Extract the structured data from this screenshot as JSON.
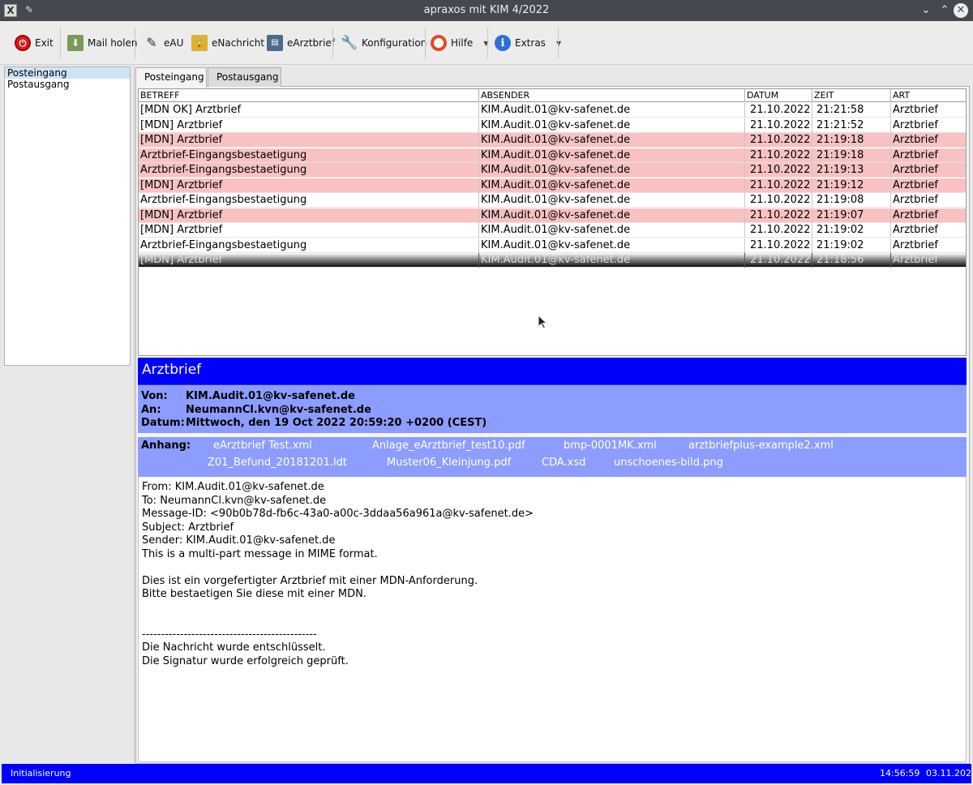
{
  "window": {
    "title": "apraxos mit KIM 4/2022",
    "app_icon": "x-app-icon",
    "pin_icon": "pin-icon",
    "min_glyph": "⌄",
    "max_glyph": "⌃",
    "close_glyph": "✕"
  },
  "toolbar": {
    "items": [
      {
        "label": "Exit",
        "icon": "power-icon",
        "glyph": "⏻"
      },
      {
        "label": "Mail holen",
        "icon": "download-icon",
        "glyph": "⬇"
      },
      {
        "label": "eAU",
        "icon": "pen-icon",
        "glyph": "✎"
      },
      {
        "label": "eNachricht",
        "icon": "lock-icon",
        "glyph": "🔒"
      },
      {
        "label": "eArztbrief",
        "icon": "printer-icon",
        "glyph": "▤"
      },
      {
        "label": "Konfiguration",
        "icon": "wrench-icon",
        "glyph": "🔧"
      },
      {
        "label": "Hilfe",
        "icon": "lifebuoy-icon",
        "glyph": ""
      },
      {
        "label": "Extras",
        "icon": "info-icon",
        "glyph": "i"
      }
    ],
    "dropdown_glyph": "▼"
  },
  "sidebar": {
    "items": [
      "Posteingang",
      "Postausgang"
    ]
  },
  "tabs": [
    "Posteingang",
    "Postausgang"
  ],
  "table": {
    "columns": [
      "BETREFF",
      "ABSENDER",
      "DATUM",
      "ZEIT",
      "ART"
    ],
    "rows": [
      {
        "betreff": "[MDN OK] Arztbrief",
        "absender": "KIM.Audit.01@kv-safenet.de",
        "datum": "21.10.2022",
        "zeit": "21:21:58",
        "art": "Arztbrief",
        "state": "normal"
      },
      {
        "betreff": "[MDN] Arztbrief",
        "absender": "KIM.Audit.01@kv-safenet.de",
        "datum": "21.10.2022",
        "zeit": "21:21:52",
        "art": "Arztbrief",
        "state": "normal"
      },
      {
        "betreff": "[MDN] Arztbrief",
        "absender": "KIM.Audit.01@kv-safenet.de",
        "datum": "21.10.2022",
        "zeit": "21:19:18",
        "art": "Arztbrief",
        "state": "unread"
      },
      {
        "betreff": "Arztbrief-Eingangsbestaetigung",
        "absender": "KIM.Audit.01@kv-safenet.de",
        "datum": "21.10.2022",
        "zeit": "21:19:18",
        "art": "Arztbrief",
        "state": "unread"
      },
      {
        "betreff": "Arztbrief-Eingangsbestaetigung",
        "absender": "KIM.Audit.01@kv-safenet.de",
        "datum": "21.10.2022",
        "zeit": "21:19:13",
        "art": "Arztbrief",
        "state": "unread"
      },
      {
        "betreff": "[MDN] Arztbrief",
        "absender": "KIM.Audit.01@kv-safenet.de",
        "datum": "21.10.2022",
        "zeit": "21:19:12",
        "art": "Arztbrief",
        "state": "unread"
      },
      {
        "betreff": "Arztbrief-Eingangsbestaetigung",
        "absender": "KIM.Audit.01@kv-safenet.de",
        "datum": "21.10.2022",
        "zeit": "21:19:08",
        "art": "Arztbrief",
        "state": "normal"
      },
      {
        "betreff": "[MDN] Arztbrief",
        "absender": "KIM.Audit.01@kv-safenet.de",
        "datum": "21.10.2022",
        "zeit": "21:19:07",
        "art": "Arztbrief",
        "state": "unread"
      },
      {
        "betreff": "[MDN] Arztbrief",
        "absender": "KIM.Audit.01@kv-safenet.de",
        "datum": "21.10.2022",
        "zeit": "21:19:02",
        "art": "Arztbrief",
        "state": "normal"
      },
      {
        "betreff": "Arztbrief-Eingangsbestaetigung",
        "absender": "KIM.Audit.01@kv-safenet.de",
        "datum": "21.10.2022",
        "zeit": "21:19:02",
        "art": "Arztbrief",
        "state": "normal"
      },
      {
        "betreff": "[MDN] Arztbrief",
        "absender": "KIM.Audit.01@kv-safenet.de",
        "datum": "21.10.2022",
        "zeit": "21:18:56",
        "art": "Arztbrief",
        "state": "selected"
      }
    ]
  },
  "preview": {
    "title": "Arztbrief",
    "von_label": "Von:",
    "von": "KIM.Audit.01@kv-safenet.de",
    "an_label": "An:",
    "an": "NeumannCl.kvn@kv-safenet.de",
    "datum_label": "Datum:",
    "datum": "Mittwoch, den 19 Oct 2022 20:59:20 +0200 (CEST)",
    "anhang_label": "Anhang:",
    "attachments": [
      "eArztbrief Test.xml",
      "Anlage_eArztbrief_test10.pdf",
      "bmp-0001MK.xml",
      "arztbriefplus-example2.xml",
      "Z01_Befund_20181201.ldt",
      "Muster06_Kleinjung.pdf",
      "CDA.xsd",
      "unschoenes-bild.png"
    ],
    "body_lines": [
      "From: KIM.Audit.01@kv-safenet.de",
      "To: NeumannCl.kvn@kv-safenet.de",
      "Message-ID: <90b0b78d-fb6c-43a0-a00c-3ddaa56a961a@kv-safenet.de>",
      "Subject: Arztbrief",
      "Sender: KIM.Audit.01@kv-safenet.de",
      "This is a multi-part message in MIME format.",
      "",
      "Dies ist ein vorgefertigter Arztbrief mit einer MDN-Anforderung.",
      "Bitte bestaetigen Sie diese mit einer MDN.",
      "",
      "",
      "----------------------------------------------",
      "Die Nachricht wurde entschlüsselt.",
      "Die Signatur wurde erfolgreich geprüft."
    ]
  },
  "statusbar": {
    "status": "Initialisierung",
    "time": "14:56:59",
    "date": "03.11.2022"
  },
  "colors": {
    "header_blue": "#0000ff",
    "meta_blue": "#8c9dff",
    "unread_row": "#f8c2c2"
  }
}
